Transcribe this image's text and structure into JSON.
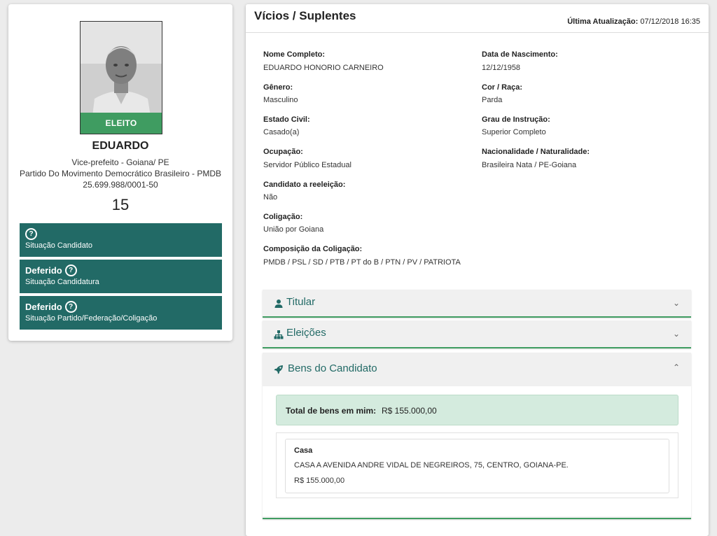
{
  "candidate": {
    "badge": "ELEITO",
    "name": "EDUARDO",
    "role": "Vice-prefeito - Goiana/ PE",
    "party": "Partido Do Movimento Democrático Brasileiro - PMDB",
    "cnpj": "25.699.988/0001-50",
    "number": "15"
  },
  "status": [
    {
      "value": "",
      "label": "Situação Candidato"
    },
    {
      "value": "Deferido",
      "label": "Situação Candidatura"
    },
    {
      "value": "Deferido",
      "label": "Situação Partido/Federação/Coligação"
    }
  ],
  "header": {
    "title": "Vícios / Suplentes",
    "update_label": "Última Atualização:",
    "update_value": "07/12/2018 16:35"
  },
  "fields": {
    "nome_label": "Nome Completo:",
    "nome_value": "EDUARDO HONORIO CARNEIRO",
    "nasc_label": "Data de Nascimento:",
    "nasc_value": "12/12/1958",
    "genero_label": "Gênero:",
    "genero_value": "Masculino",
    "cor_label": "Cor / Raça:",
    "cor_value": "Parda",
    "civil_label": "Estado Civil:",
    "civil_value": "Casado(a)",
    "grau_label": "Grau de Instrução:",
    "grau_value": "Superior Completo",
    "ocup_label": "Ocupação:",
    "ocup_value": "Servidor Público Estadual",
    "nac_label": "Nacionalidade / Naturalidade:",
    "nac_value": "Brasileira Nata / PE-Goiana",
    "reeleicao_label": "Candidato a reeleição:",
    "reeleicao_value": "Não",
    "colig_label": "Coligação:",
    "colig_value": "União por Goiana",
    "comp_label": "Composição da Coligação:",
    "comp_value": "PMDB / PSL / SD / PTB / PT do B / PTN / PV / PATRIOTA"
  },
  "accordions": {
    "titular": "Titular",
    "eleicoes": "Eleições",
    "bens": "Bens do Candidato"
  },
  "bens": {
    "total_label": "Total de bens em mim:",
    "total_value": "R$ 155.000,00",
    "item": {
      "type": "Casa",
      "description": "CASA A AVENIDA ANDRE VIDAL DE NEGREIROS, 75, CENTRO, GOIANA-PE.",
      "value": "R$ 155.000,00"
    }
  },
  "colors": {
    "accent": "#226a66",
    "elected": "#3f9c61",
    "total_bg": "#d4ebde"
  },
  "icons": [
    "question-icon",
    "user-icon",
    "sitemap-icon",
    "rocket-icon",
    "chevron-down-icon",
    "chevron-up-icon"
  ]
}
